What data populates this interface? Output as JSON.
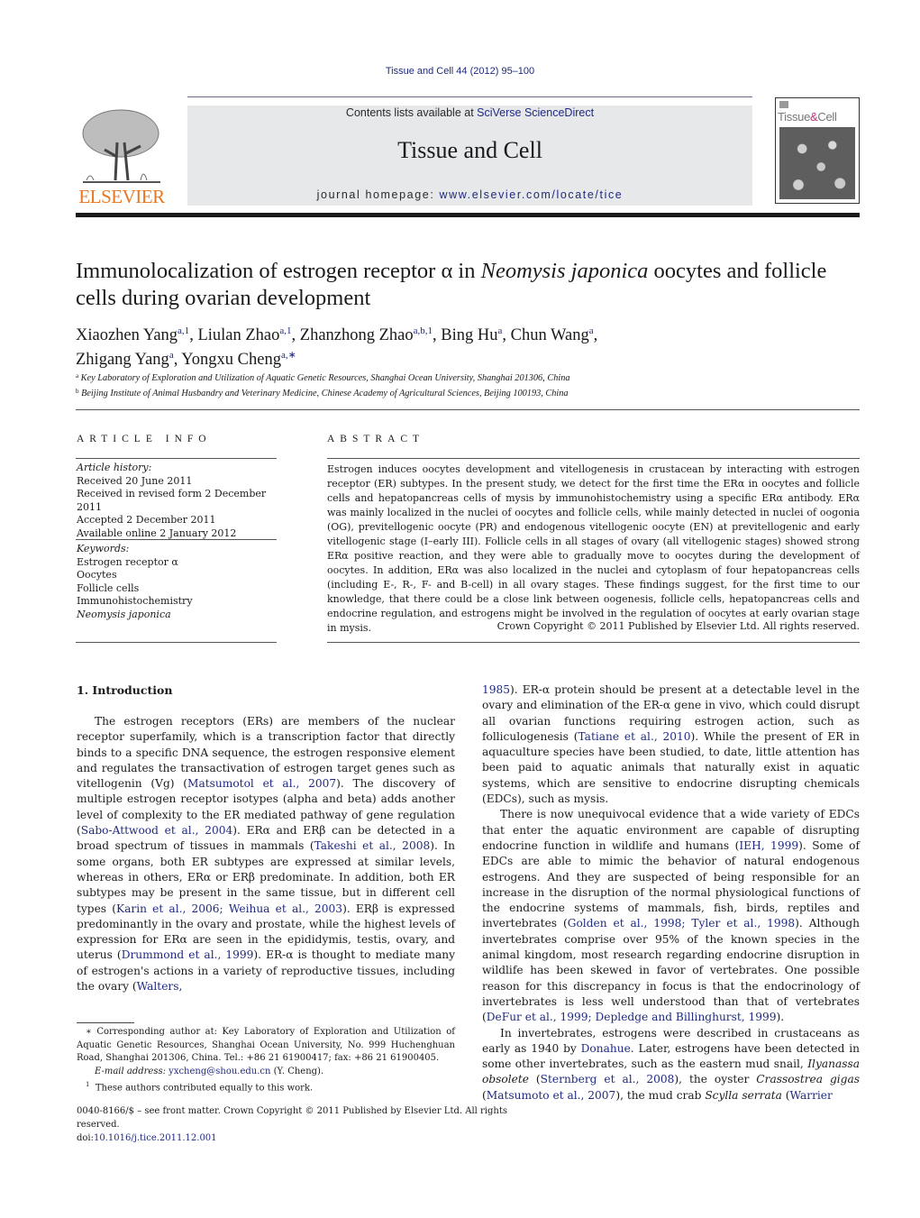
{
  "citation_header": "Tissue and Cell 44 (2012) 95–100",
  "masthead": {
    "contents_prefix": "Contents lists available at ",
    "contents_link": "SciVerse ScienceDirect",
    "journal_name": "Tissue and Cell",
    "homepage_prefix": "journal homepage: ",
    "homepage_link": "www.elsevier.com/locate/tice"
  },
  "publisher_logo": {
    "icon": "elsevier-tree-icon",
    "wordmark": "ELSEVIER",
    "color": "#e87722"
  },
  "cover": {
    "title_part1": "Tissue",
    "title_amp": "&",
    "title_part2": "Cell",
    "accent": "#c0307a"
  },
  "article": {
    "title_part1": "Immunolocalization of estrogen receptor α in ",
    "title_species": "Neomysis japonica",
    "title_part2": " oocytes and follicle cells during ovarian development",
    "authors": [
      {
        "name": "Xiaozhen Yang",
        "sup": "a,1",
        "sep": ", "
      },
      {
        "name": "Liulan Zhao",
        "sup": "a,1",
        "sep": ", "
      },
      {
        "name": "Zhanzhong Zhao",
        "sup": "a,b,1",
        "sep": ", "
      },
      {
        "name": "Bing Hu",
        "sup": "a",
        "sep": ", "
      },
      {
        "name": "Chun Wang",
        "sup": "a",
        "sep": ","
      },
      {
        "name": "Zhigang Yang",
        "sup": "a",
        "sep": ", "
      },
      {
        "name": "Yongxu Cheng",
        "sup": "a,∗",
        "sep": ""
      }
    ],
    "affiliations": [
      {
        "mark": "a",
        "text": "Key Laboratory of Exploration and Utilization of Aquatic Genetic Resources, Shanghai Ocean University, Shanghai 201306, China"
      },
      {
        "mark": "b",
        "text": "Beijing Institute of Animal Husbandry and Veterinary Medicine, Chinese Academy of Agricultural Sciences, Beijing 100193, China"
      }
    ]
  },
  "article_info": {
    "heading": "ARTICLE INFO",
    "history_label": "Article history:",
    "history": [
      "Received 20 June 2011",
      "Received in revised form 2 December 2011",
      "Accepted 2 December 2011",
      "Available online 2 January 2012"
    ],
    "keywords_label": "Keywords:",
    "keywords": [
      "Estrogen receptor α",
      "Oocytes",
      "Follicle cells",
      "Immunohistochemistry",
      "Neomysis japonica"
    ]
  },
  "abstract": {
    "heading": "ABSTRACT",
    "text": "Estrogen induces oocytes development and vitellogenesis in crustacean by interacting with estrogen receptor (ER) subtypes. In the present study, we detect for the first time the ERα in oocytes and follicle cells and hepatopancreas cells of mysis by immunohistochemistry using a specific ERα antibody. ERα was mainly localized in the nuclei of oocytes and follicle cells, while mainly detected in nuclei of oogonia (OG), previtellogenic oocyte (PR) and endogenous vitellogenic oocyte (EN) at previtellogenic and early vitellogenic stage (I–early III). Follicle cells in all stages of ovary (all vitellogenic stages) showed strong ERα positive reaction, and they were able to gradually move to oocytes during the development of oocytes. In addition, ERα was also localized in the nuclei and cytoplasm of four hepatopancreas cells (including E-, R-, F- and B-cell) in all ovary stages. These findings suggest, for the first time to our knowledge, that there could be a close link between oogenesis, follicle cells, hepatopancreas cells and endocrine regulation, and estrogens might be involved in the regulation of oocytes at early ovarian stage in mysis.",
    "copyright": "Crown Copyright © 2011 Published by Elsevier Ltd. All rights reserved."
  },
  "introduction": {
    "heading": "1.  Introduction",
    "col1_p1": [
      {
        "t": "The estrogen receptors (ERs) are members of the nuclear receptor superfamily, which is a transcription factor that directly binds to a specific DNA sequence, the estrogen responsive element and regulates the transactivation of estrogen target genes such as vitellogenin (Vg) ("
      },
      {
        "l": "Matsumotol et al., 2007"
      },
      {
        "t": "). The discovery of multiple estrogen receptor isotypes (alpha and beta) adds another level of complexity to the ER mediated pathway of gene regulation ("
      },
      {
        "l": "Sabo-Attwood et al., 2004"
      },
      {
        "t": "). ERα and ERβ can be detected in a broad spectrum of tissues in mammals ("
      },
      {
        "l": "Takeshi et al., 2008"
      },
      {
        "t": "). In some organs, both ER subtypes are expressed at similar levels, whereas in others, ERα or ERβ predominate. In addition, both ER subtypes may be present in the same tissue, but in different cell types ("
      },
      {
        "l": "Karin et al., 2006; Weihua et al., 2003"
      },
      {
        "t": "). ERβ is expressed predominantly in the ovary and prostate, while the highest levels of expression for ERα are seen in the epididymis, testis, ovary, and uterus ("
      },
      {
        "l": "Drummond et al., 1999"
      },
      {
        "t": "). ER-α is thought to mediate many of estrogen's actions in a variety of reproductive tissues, including the ovary ("
      },
      {
        "l": "Walters,"
      }
    ],
    "col2_p1": [
      {
        "l": "1985"
      },
      {
        "t": "). ER-α protein should be present at a detectable level in the ovary and elimination of the ER-α gene in vivo, which could disrupt all ovarian functions requiring estrogen action, such as folliculogenesis ("
      },
      {
        "l": "Tatiane et al., 2010"
      },
      {
        "t": "). While the present of ER in aquaculture species have been studied, to date, little attention has been paid to aquatic animals that naturally exist in aquatic systems, which are sensitive to endocrine disrupting chemicals (EDCs), such as mysis."
      }
    ],
    "col2_p2": [
      {
        "t": "There is now unequivocal evidence that a wide variety of EDCs that enter the aquatic environment are capable of disrupting endocrine function in wildlife and humans ("
      },
      {
        "l": "IEH, 1999"
      },
      {
        "t": "). Some of EDCs are able to mimic the behavior of natural endogenous estrogens. And they are suspected of being responsible for an increase in the disruption of the normal physiological functions of the endocrine systems of mammals, fish, birds, reptiles and invertebrates ("
      },
      {
        "l": "Golden et al., 1998; Tyler et al., 1998"
      },
      {
        "t": "). Although invertebrates comprise over 95% of the known species in the animal kingdom, most research regarding endocrine disruption in wildlife has been skewed in favor of vertebrates. One possible reason for this discrepancy in focus is that the endocrinology of invertebrates is less well understood than that of vertebrates ("
      },
      {
        "l": "DeFur et al., 1999; Depledge and Billinghurst, 1999"
      },
      {
        "t": ")."
      }
    ],
    "col2_p3": [
      {
        "t": "In invertebrates, estrogens were described in crustaceans as early as 1940 by "
      },
      {
        "l": "Donahue"
      },
      {
        "t": ". Later, estrogens have been detected in some other invertebrates, such as the eastern mud snail, "
      },
      {
        "i": "Ilyanassa obsolete"
      },
      {
        "t": " ("
      },
      {
        "l": "Sternberg et al., 2008"
      },
      {
        "t": "), the oyster "
      },
      {
        "i": "Crassostrea gigas"
      },
      {
        "t": " ("
      },
      {
        "l": "Matsumoto et al., 2007"
      },
      {
        "t": "), the mud crab "
      },
      {
        "i": "Scylla serrata"
      },
      {
        "t": " ("
      },
      {
        "l": "Warrier"
      }
    ]
  },
  "footnotes": {
    "corresponding_prefix": "∗ Corresponding author at: Key Laboratory of Exploration and Utilization of Aquatic Genetic Resources, Shanghai Ocean University, No. 999 Huchenghuan Road, Shanghai 201306, China. Tel.: +86 21 61900417; fax: +86 21 61900405.",
    "email_label": "E-mail address:",
    "email": "yxcheng@shou.edu.cn",
    "email_suffix": " (Y. Cheng).",
    "equal_mark": "1",
    "equal_text": "These authors contributed equally to this work."
  },
  "front_matter": {
    "issn_line": "0040-8166/$ – see front matter. Crown Copyright © 2011 Published by Elsevier Ltd. All rights reserved.",
    "doi_prefix": "doi:",
    "doi": "10.1016/j.tice.2011.12.001"
  },
  "colors": {
    "link": "#1f2a80",
    "masthead_bg": "#e7e8ea",
    "rule": "#1a1a1a"
  }
}
